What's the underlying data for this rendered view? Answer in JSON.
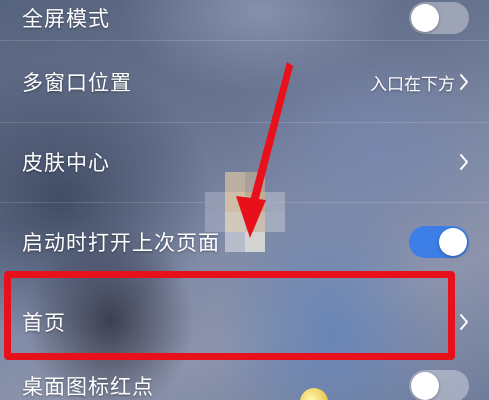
{
  "settings": {
    "fullscreen_mode": {
      "label": "全屏模式",
      "toggle": "off"
    },
    "multi_window_position": {
      "label": "多窗口位置",
      "value": "入口在下方"
    },
    "skin_center": {
      "label": "皮肤中心"
    },
    "open_last_page": {
      "label": "启动时打开上次页面",
      "toggle": "on"
    },
    "home_page": {
      "label": "首页"
    },
    "desktop_icon_red_dot": {
      "label": "桌面图标红点",
      "toggle": "off"
    }
  },
  "colors": {
    "toggle_on": "#3d7ee6",
    "annotation_red": "#e8101a"
  }
}
